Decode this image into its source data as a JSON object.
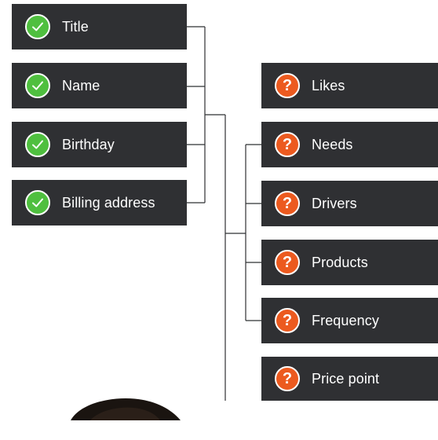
{
  "known_fields": [
    {
      "label": "Title",
      "icon": "check-icon"
    },
    {
      "label": "Name",
      "icon": "check-icon"
    },
    {
      "label": "Birthday",
      "icon": "check-icon"
    },
    {
      "label": "Billing address",
      "icon": "check-icon"
    }
  ],
  "unknown_fields": [
    {
      "label": "Likes",
      "icon": "question-icon",
      "glyph": "?"
    },
    {
      "label": "Needs",
      "icon": "question-icon",
      "glyph": "?"
    },
    {
      "label": "Drivers",
      "icon": "question-icon",
      "glyph": "?"
    },
    {
      "label": "Products",
      "icon": "question-icon",
      "glyph": "?"
    },
    {
      "label": "Frequency",
      "icon": "question-icon",
      "glyph": "?"
    },
    {
      "label": "Price point",
      "icon": "question-icon",
      "glyph": "?"
    }
  ],
  "colors": {
    "card_background": "#2f3033",
    "known_icon": "#4fbf3f",
    "unknown_icon": "#ec5a1f",
    "connector": "#2f3033"
  }
}
